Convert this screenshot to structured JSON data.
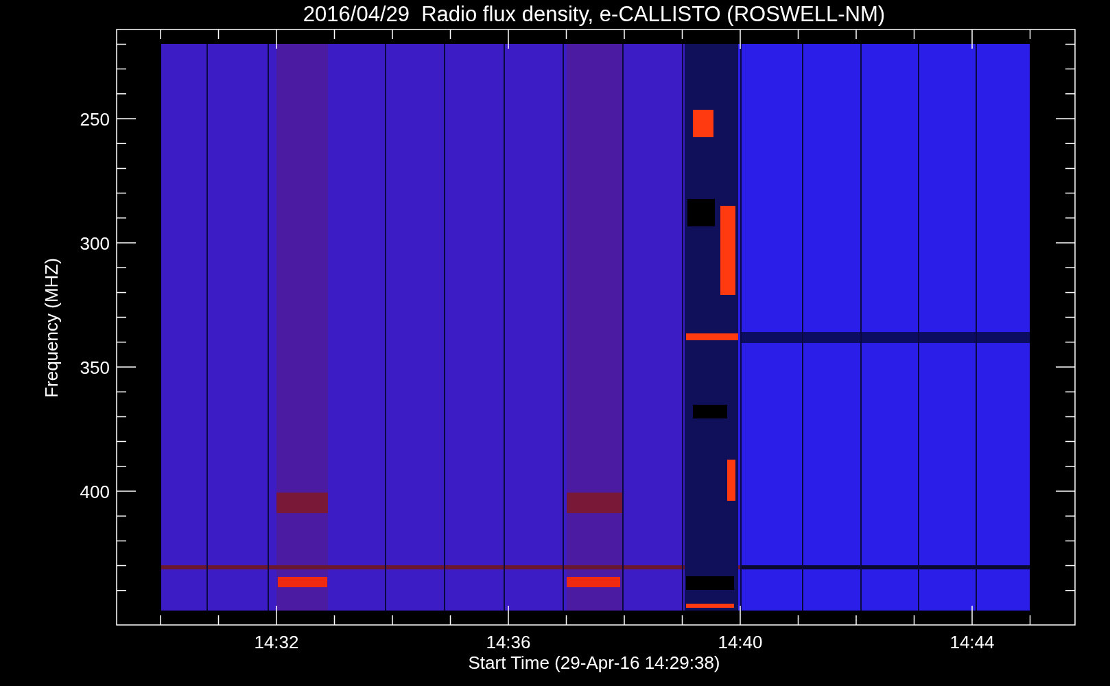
{
  "title": "2016/04/29  Radio flux density, e-CALLISTO (ROSWELL-NM)",
  "y_axis": {
    "label": "Frequency (MHZ)",
    "tick_labels": [
      "250",
      "300",
      "350",
      "400"
    ]
  },
  "x_axis": {
    "label": "Start Time (29-Apr-16 14:29:38)",
    "tick_labels": [
      "14:32",
      "14:36",
      "14:40",
      "14:44"
    ]
  }
}
